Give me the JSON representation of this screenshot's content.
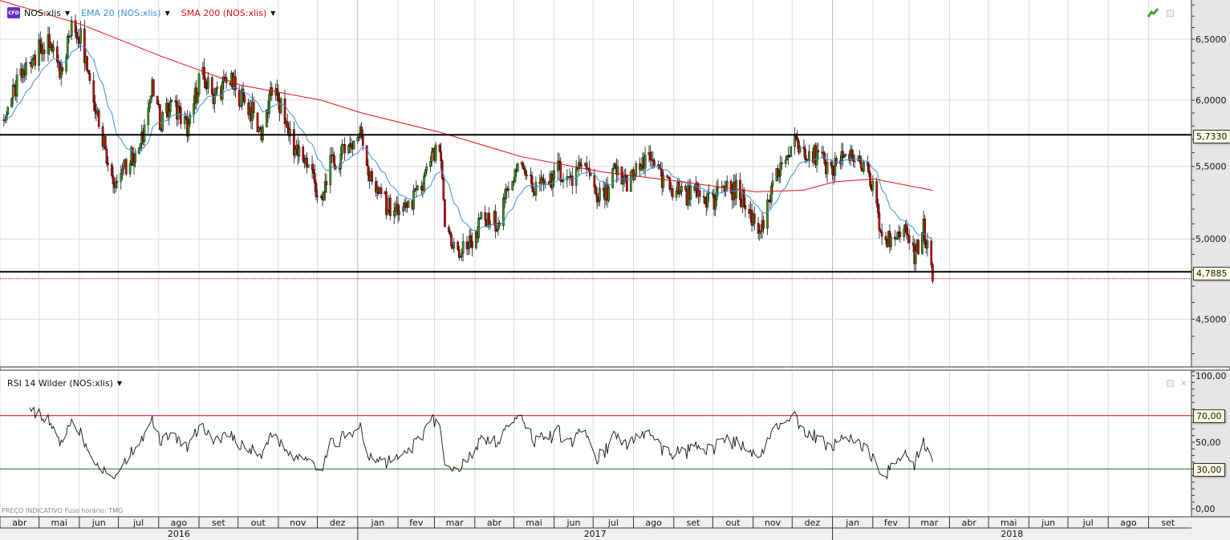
{
  "legend": {
    "instrument": "NOS:xlis",
    "instrument_badge": "CFD",
    "ema": "EMA 20 (NOS:xlis)",
    "sma": "SMA 200 (NOS:xlis)",
    "rsi": "RSI 14 Wilder (NOS:xlis)"
  },
  "colors": {
    "up": "#3a9a1a",
    "down": "#d40000",
    "ema": "#3d94d6",
    "sma": "#e01010",
    "rsi": "#111111"
  },
  "footnote": "PREÇO INDICATIVO   Fuso horário: TMG",
  "chart_data": [
    {
      "type": "candlestick",
      "title": "NOS:xlis",
      "scale": "log",
      "start_date": "2016-04-01",
      "x_range_days": [
        0,
        916
      ],
      "ylim": [
        4.2,
        6.85
      ],
      "y_ticks": [
        6.5,
        6.0,
        5.5,
        5.0,
        4.5
      ],
      "y_tick_labels": [
        "6,5000",
        "6,0000",
        "5,5000",
        "5,0000",
        "4,5000"
      ],
      "horizontal_lines": [
        {
          "value": 5.733,
          "label": "5,7330"
        },
        {
          "value": 4.7885,
          "label": "4,7885"
        }
      ],
      "close_waypoints_day_price": [
        [
          3,
          5.84
        ],
        [
          12,
          6.09
        ],
        [
          25,
          6.36
        ],
        [
          37,
          6.46
        ],
        [
          46,
          6.22
        ],
        [
          56,
          6.63
        ],
        [
          62,
          6.53
        ],
        [
          71,
          6.09
        ],
        [
          77,
          5.81
        ],
        [
          83,
          5.55
        ],
        [
          89,
          5.32
        ],
        [
          99,
          5.55
        ],
        [
          108,
          5.63
        ],
        [
          117,
          6.09
        ],
        [
          123,
          5.84
        ],
        [
          133,
          5.96
        ],
        [
          145,
          5.78
        ],
        [
          154,
          6.22
        ],
        [
          164,
          6.03
        ],
        [
          176,
          6.16
        ],
        [
          185,
          6.03
        ],
        [
          194,
          5.9
        ],
        [
          201,
          5.75
        ],
        [
          210,
          6.09
        ],
        [
          219,
          5.84
        ],
        [
          228,
          5.6
        ],
        [
          238,
          5.52
        ],
        [
          247,
          5.21
        ],
        [
          253,
          5.49
        ],
        [
          265,
          5.6
        ],
        [
          278,
          5.75
        ],
        [
          284,
          5.42
        ],
        [
          293,
          5.27
        ],
        [
          302,
          5.19
        ],
        [
          315,
          5.24
        ],
        [
          324,
          5.32
        ],
        [
          330,
          5.55
        ],
        [
          338,
          5.6
        ],
        [
          342,
          5.11
        ],
        [
          352,
          4.89
        ],
        [
          361,
          4.97
        ],
        [
          370,
          5.11
        ],
        [
          379,
          5.11
        ],
        [
          386,
          5.16
        ],
        [
          392,
          5.42
        ],
        [
          401,
          5.49
        ],
        [
          410,
          5.34
        ],
        [
          420,
          5.37
        ],
        [
          429,
          5.49
        ],
        [
          438,
          5.39
        ],
        [
          450,
          5.49
        ],
        [
          457,
          5.34
        ],
        [
          463,
          5.24
        ],
        [
          472,
          5.46
        ],
        [
          481,
          5.39
        ],
        [
          494,
          5.49
        ],
        [
          503,
          5.55
        ],
        [
          509,
          5.37
        ],
        [
          518,
          5.34
        ],
        [
          531,
          5.29
        ],
        [
          540,
          5.32
        ],
        [
          549,
          5.24
        ],
        [
          555,
          5.34
        ],
        [
          568,
          5.32
        ],
        [
          577,
          5.16
        ],
        [
          586,
          5.06
        ],
        [
          592,
          5.29
        ],
        [
          602,
          5.55
        ],
        [
          611,
          5.66
        ],
        [
          620,
          5.63
        ],
        [
          629,
          5.55
        ],
        [
          639,
          5.46
        ],
        [
          645,
          5.57
        ],
        [
          654,
          5.55
        ],
        [
          663,
          5.52
        ],
        [
          669,
          5.42
        ],
        [
          676,
          5.08
        ],
        [
          682,
          4.99
        ],
        [
          691,
          5.04
        ],
        [
          700,
          5.01
        ],
        [
          703,
          4.87
        ],
        [
          710,
          5.08
        ],
        [
          713,
          4.92
        ],
        [
          717,
          4.8
        ]
      ],
      "sma200_day_price": [
        [
          0,
          6.84
        ],
        [
          62,
          6.63
        ],
        [
          123,
          6.36
        ],
        [
          185,
          6.12
        ],
        [
          247,
          6.0
        ],
        [
          278,
          5.9
        ],
        [
          339,
          5.75
        ],
        [
          401,
          5.57
        ],
        [
          463,
          5.46
        ],
        [
          524,
          5.39
        ],
        [
          581,
          5.32
        ],
        [
          617,
          5.33
        ],
        [
          642,
          5.39
        ],
        [
          672,
          5.41
        ],
        [
          717,
          5.33
        ]
      ],
      "ema_period": 20
    },
    {
      "type": "line",
      "title": "RSI 14 Wilder (NOS:xlis)",
      "period": 14,
      "ylim": [
        0,
        100
      ],
      "y_tick_labels": [
        "100,00",
        "50,00",
        "0,00"
      ],
      "y_ticks": [
        100,
        50,
        0
      ],
      "levels": [
        {
          "value": 70,
          "label": "70,00"
        },
        {
          "value": 30,
          "label": "30,00"
        }
      ]
    }
  ],
  "time_axis": {
    "months": [
      "abr",
      "mai",
      "jun",
      "jul",
      "ago",
      "set",
      "out",
      "nov",
      "dez",
      "jan",
      "fev",
      "mar",
      "abr",
      "mai",
      "jun",
      "jul",
      "ago",
      "set",
      "out",
      "nov",
      "dez",
      "jan",
      "fev",
      "mar",
      "abr",
      "mai",
      "jun",
      "jul",
      "ago",
      "set"
    ],
    "years": [
      "2016",
      "2017",
      "2018"
    ]
  }
}
